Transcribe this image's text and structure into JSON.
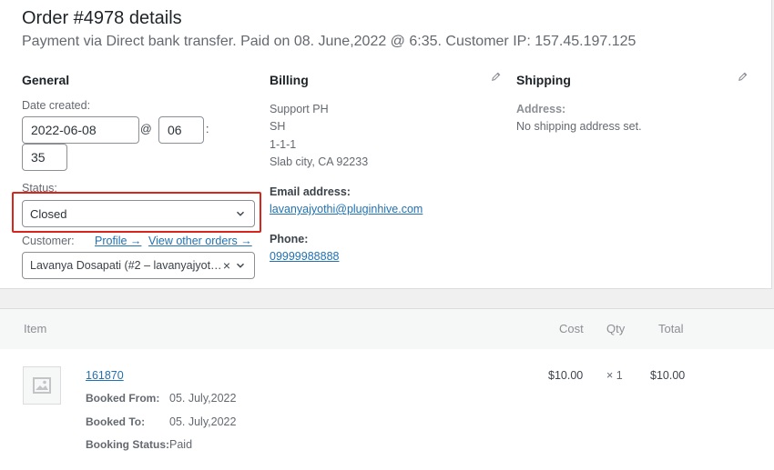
{
  "order": {
    "title": "Order #4978 details",
    "subtitle": "Payment via Direct bank transfer. Paid on 08. June,2022 @ 6:35. Customer IP: 157.45.197.125"
  },
  "general": {
    "heading": "General",
    "date_label": "Date created:",
    "date_value": "2022-06-08",
    "at_symbol": "@",
    "hour_value": "06",
    "colon": ":",
    "minute_value": "35",
    "status_label": "Status:",
    "status_value": "Closed",
    "customer_label": "Customer:",
    "profile_link": "Profile →",
    "view_orders_link": "View other orders →",
    "customer_value": "Lavanya Dosapati (#2 – lavanyajyot…",
    "clear_symbol": "×"
  },
  "billing": {
    "heading": "Billing",
    "address_lines": [
      "Support PH",
      "SH",
      "1-1-1",
      "Slab city, CA 92233"
    ],
    "email_label": "Email address:",
    "email_value": "lavanyajyothi@pluginhive.com",
    "phone_label": "Phone:",
    "phone_value": "09999988888"
  },
  "shipping": {
    "heading": "Shipping",
    "address_label": "Address:",
    "address_value": "No shipping address set."
  },
  "items": {
    "headers": {
      "item": "Item",
      "cost": "Cost",
      "qty": "Qty",
      "total": "Total"
    },
    "rows": [
      {
        "name": "161870",
        "cost": "$10.00",
        "qty": "× 1",
        "total": "$10.00",
        "meta": [
          {
            "key": "Booked From:",
            "value": "05. July,2022"
          },
          {
            "key": "Booked To:",
            "value": "05. July,2022"
          },
          {
            "key": "Booking Status:",
            "value": "Paid"
          }
        ]
      }
    ]
  },
  "colors": {
    "link": "#2271b1",
    "highlight": "#d9261c"
  }
}
